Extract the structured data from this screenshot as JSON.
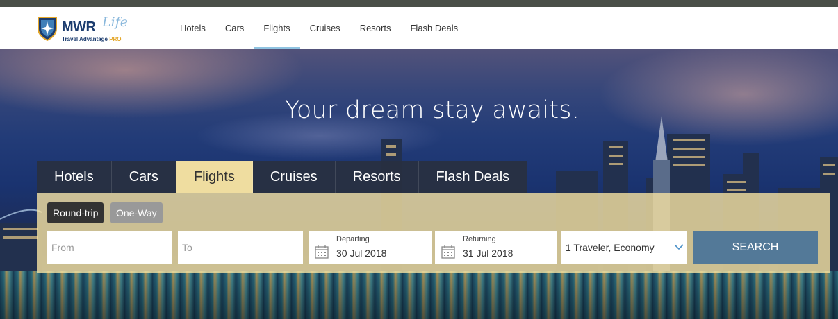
{
  "brand": {
    "name": "MWR",
    "script": "Life",
    "tagline": "Travel Advantage",
    "tagline_pro": "PRO"
  },
  "nav": {
    "items": [
      "Hotels",
      "Cars",
      "Flights",
      "Cruises",
      "Resorts",
      "Flash Deals"
    ],
    "active": "Flights"
  },
  "hero": {
    "headline": "Your dream stay awaits."
  },
  "search": {
    "tabs": [
      "Hotels",
      "Cars",
      "Flights",
      "Cruises",
      "Resorts",
      "Flash Deals"
    ],
    "active_tab": "Flights",
    "trip_types": [
      "Round-trip",
      "One-Way"
    ],
    "selected_trip": "Round-trip",
    "from": {
      "placeholder": "From",
      "value": ""
    },
    "to": {
      "placeholder": "To",
      "value": ""
    },
    "departing": {
      "label": "Departing",
      "value": "30 Jul 2018"
    },
    "returning": {
      "label": "Returning",
      "value": "31 Jul 2018"
    },
    "travelers": "1 Traveler, Economy",
    "search_label": "SEARCH"
  },
  "colors": {
    "accent": "#8fc3e1",
    "panel": "#f8e4a2",
    "button": "#537998",
    "brand": "#1c3c6e"
  }
}
